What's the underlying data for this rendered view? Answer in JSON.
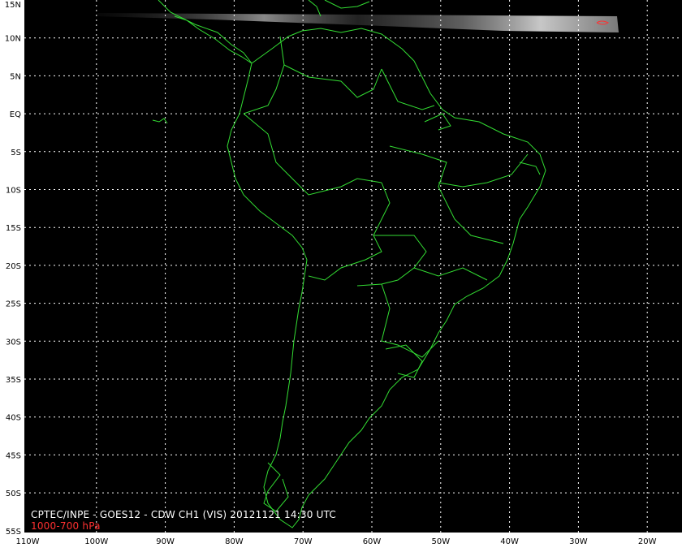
{
  "caption": {
    "title": "CPTEC/INPE - GOES12 - CDW CH1 (VIS) 20121121 14:30 UTC",
    "level": "1000-700 hPa"
  },
  "grid": {
    "latitudes": [
      "15N",
      "10N",
      "5N",
      "EQ",
      "5S",
      "10S",
      "15S",
      "20S",
      "25S",
      "30S",
      "35S",
      "40S",
      "45S",
      "50S",
      "55S"
    ],
    "longitudes": [
      "110W",
      "100W",
      "90W",
      "80W",
      "70W",
      "60W",
      "50W",
      "40W",
      "30W",
      "20W"
    ]
  },
  "colors": {
    "map_background": "#000000",
    "frame": "#ffffff",
    "coastline": "#33dd33",
    "grid": "#ffffff",
    "label_text": "#000000",
    "caption_text": "#ffffff",
    "level_text": "#ff3030"
  }
}
